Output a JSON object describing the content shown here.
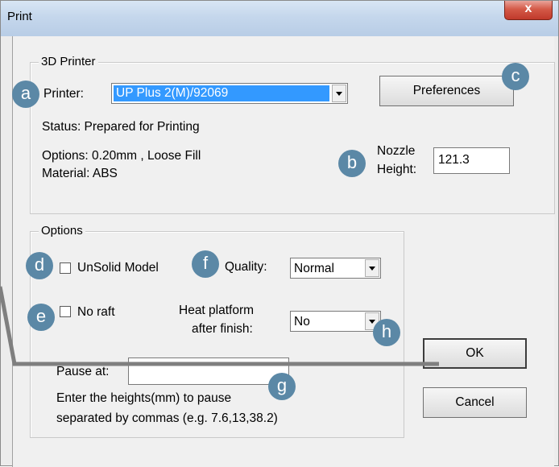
{
  "window": {
    "title": "Print",
    "close_glyph": "x"
  },
  "printer_group": {
    "legend": "3D Printer",
    "printer_label": "Printer:",
    "printer_value": "UP Plus 2(M)/92069",
    "preferences_label": "Preferences",
    "status": "Status: Prepared for Printing",
    "options": "Options: 0.20mm , Loose Fill",
    "material": "Material: ABS",
    "nozzle_label_1": "Nozzle",
    "nozzle_label_2": "Height:",
    "nozzle_value": "121.3"
  },
  "options_group": {
    "legend": "Options",
    "unsolid_label": "UnSolid Model",
    "quality_label": "Quality:",
    "quality_value": "Normal",
    "noraft_label": "No raft",
    "heat_label_1": "Heat platform",
    "heat_label_2": "after finish:",
    "heat_value": "No",
    "pause_label": "Pause at:",
    "pause_value": "",
    "hint_1": "Enter the heights(mm) to pause",
    "hint_2": "separated by commas (e.g. 7.6,13,38.2)"
  },
  "buttons": {
    "ok": "OK",
    "cancel": "Cancel"
  },
  "annotations": {
    "a": "a",
    "b": "b",
    "c": "c",
    "d": "d",
    "e": "e",
    "f": "f",
    "g": "g",
    "h": "h"
  },
  "colors": {
    "badge": "#5b88a6",
    "selection": "#3399ff",
    "title_bar": "#c5d7ec",
    "close_button": "#c0392b"
  }
}
